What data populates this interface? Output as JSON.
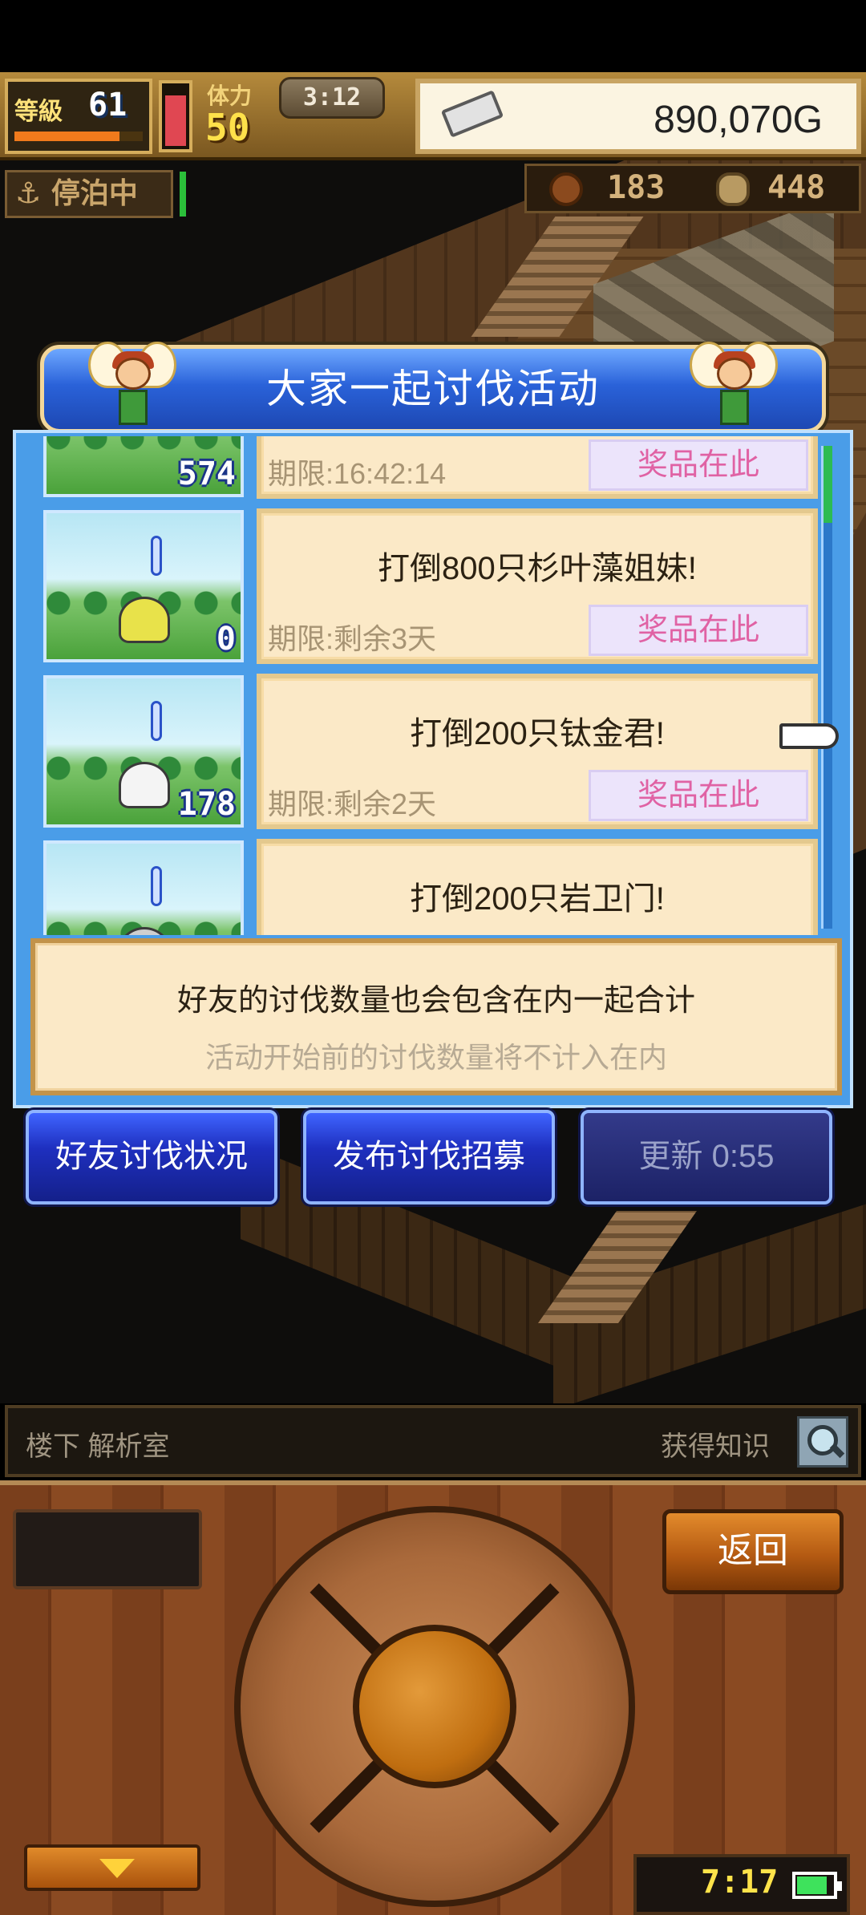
{
  "hud": {
    "level_label": "等級",
    "level": "61",
    "xp_fraction": 0.82,
    "hp_fraction": 0.86,
    "stamina_label": "体力",
    "stamina": "50",
    "clock": "3:12",
    "gold": "890,070G",
    "status": "停泊中",
    "resources": [
      {
        "icon": "meat-icon",
        "value": "183"
      },
      {
        "icon": "coin-icon",
        "value": "448"
      }
    ]
  },
  "dialog": {
    "title": "大家一起讨伐活动",
    "scroll_fraction": 0.16,
    "events": [
      {
        "task": "",
        "deadline": "期限:16:42:14",
        "prize": "奖品在此",
        "count": "574",
        "monster": "none"
      },
      {
        "task": "打倒800只杉叶藻姐妹!",
        "deadline": "期限:剩余3天",
        "prize": "奖品在此",
        "count": "0",
        "monster": "yellow"
      },
      {
        "task": "打倒200只钛金君!",
        "deadline": "期限:剩余2天",
        "prize": "奖品在此",
        "count": "178",
        "monster": "white"
      },
      {
        "task": "打倒200只岩卫门!",
        "deadline": "",
        "prize": "",
        "count": "",
        "monster": "gray"
      }
    ],
    "info_main": "好友的讨伐数量也会包含在内一起合计",
    "info_sub": "活动开始前的讨伐数量将不计入在内",
    "buttons": {
      "friends": "好友讨伐状况",
      "recruit": "发布讨伐招募",
      "refresh": "更新 0:55"
    }
  },
  "bottom": {
    "location": "楼下 解析室",
    "knowledge": "获得知识",
    "back": "返回",
    "time": "7:17",
    "battery_fraction": 0.85
  },
  "colors": {
    "title_blue": "#2a62d9",
    "prize_pink": "#e062a4",
    "gold_text": "#ffe14a"
  }
}
